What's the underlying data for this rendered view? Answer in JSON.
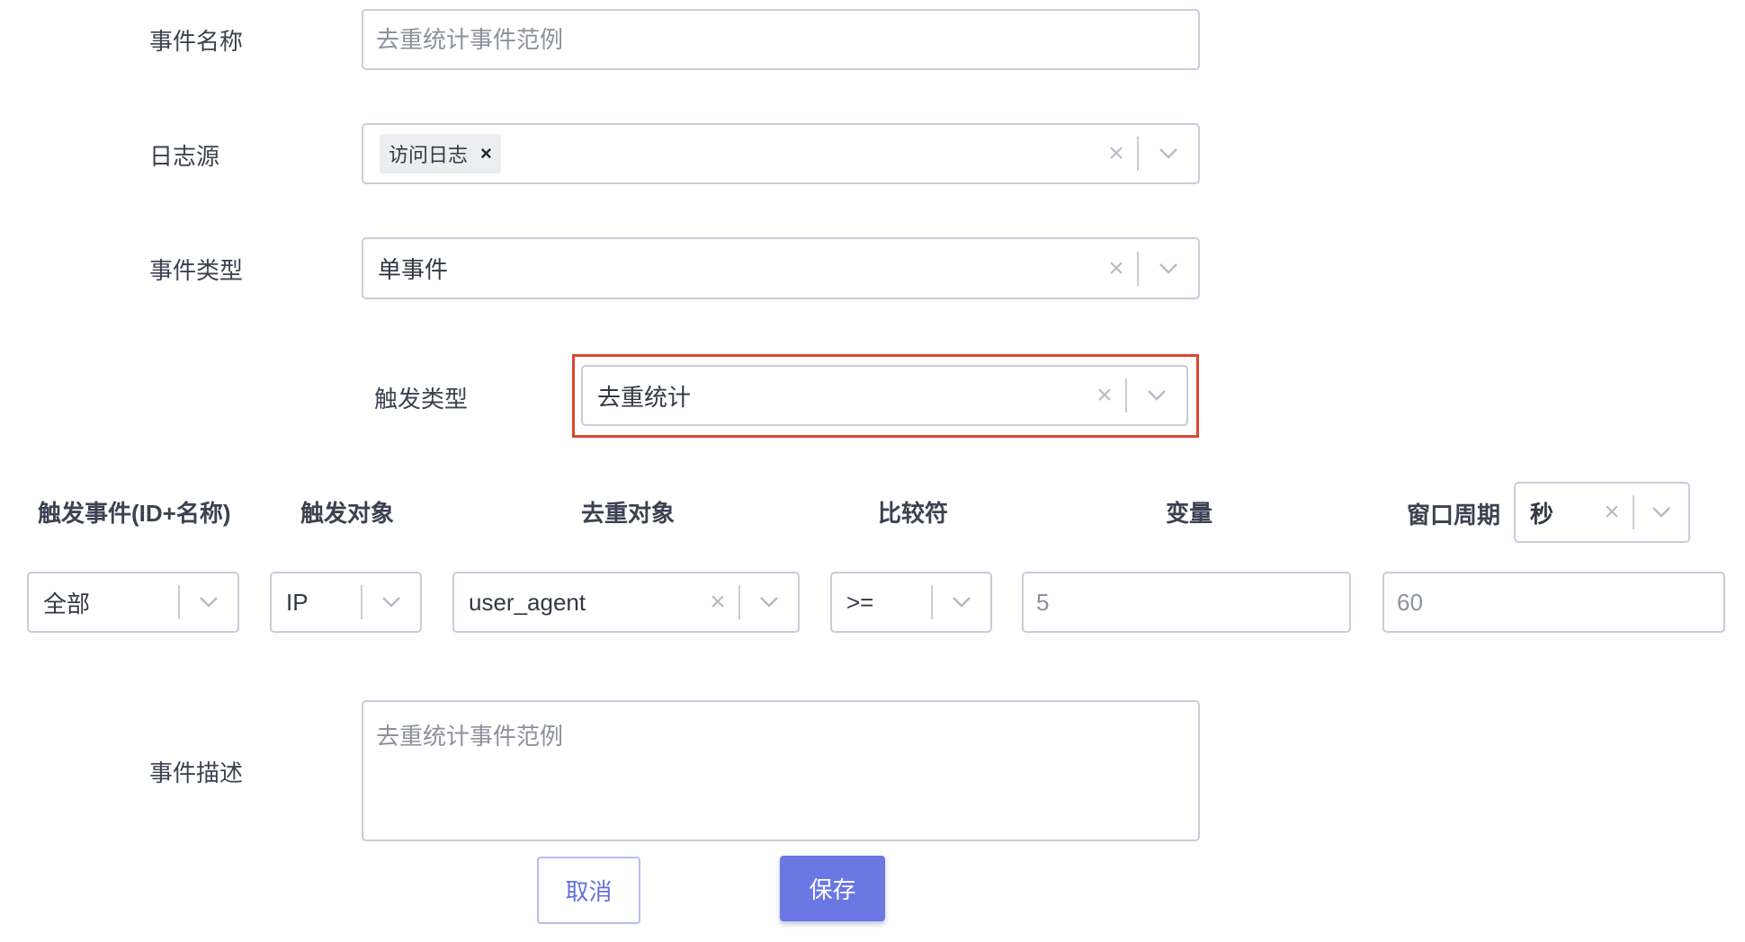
{
  "form": {
    "event_name": {
      "label": "事件名称",
      "placeholder": "去重统计事件范例"
    },
    "log_source": {
      "label": "日志源",
      "tag": "访问日志",
      "tag_remove": "×"
    },
    "event_type": {
      "label": "事件类型",
      "value": "单事件"
    },
    "trigger_type": {
      "label": "触发类型",
      "value": "去重统计"
    },
    "columns": {
      "trigger_event": "触发事件(ID+名称)",
      "trigger_object": "触发对象",
      "dedup_object": "去重对象",
      "comparator": "比较符",
      "variable": "变量",
      "window_period": "窗口周期"
    },
    "window_unit": {
      "value": "秒"
    },
    "row": {
      "trigger_event_value": "全部",
      "trigger_object_value": "IP",
      "dedup_object_value": "user_agent",
      "comparator_value": ">=",
      "variable_value": "5",
      "window_period_value": "60"
    },
    "description": {
      "label": "事件描述",
      "placeholder": "去重统计事件范例"
    },
    "buttons": {
      "cancel": "取消",
      "save": "保存"
    },
    "icons": {
      "clear": "×"
    }
  },
  "colors": {
    "highlight_border": "#e0452f",
    "primary": "#6b77e3",
    "border": "#c9ccd8"
  }
}
